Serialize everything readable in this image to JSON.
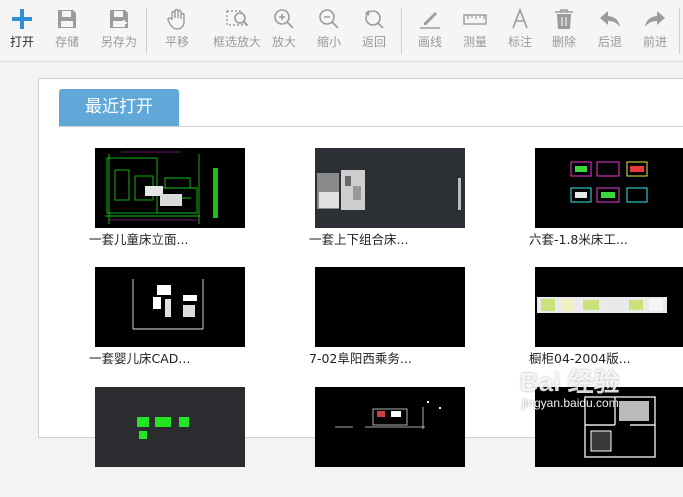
{
  "toolbar": {
    "items": [
      {
        "label": "打开",
        "icon": "plus-icon",
        "state": "active"
      },
      {
        "label": "存储",
        "icon": "save-icon",
        "state": "disabled"
      },
      {
        "label": "另存为",
        "icon": "save-as-icon",
        "state": "disabled"
      },
      {
        "label": "平移",
        "icon": "hand-icon",
        "state": "disabled"
      },
      {
        "label": "框选放大",
        "icon": "zoom-window-icon",
        "state": "disabled"
      },
      {
        "label": "放大",
        "icon": "zoom-in-icon",
        "state": "disabled"
      },
      {
        "label": "缩小",
        "icon": "zoom-out-icon",
        "state": "disabled"
      },
      {
        "label": "返回",
        "icon": "zoom-back-icon",
        "state": "disabled"
      },
      {
        "label": "画线",
        "icon": "pencil-icon",
        "state": "disabled"
      },
      {
        "label": "测量",
        "icon": "ruler-icon",
        "state": "disabled"
      },
      {
        "label": "标注",
        "icon": "text-a-icon",
        "state": "disabled"
      },
      {
        "label": "删除",
        "icon": "trash-icon",
        "state": "disabled"
      },
      {
        "label": "后退",
        "icon": "undo-arrow-icon",
        "state": "disabled"
      },
      {
        "label": "前进",
        "icon": "redo-arrow-icon",
        "state": "disabled"
      }
    ]
  },
  "recent": {
    "tab_label": "最近打开",
    "files": [
      {
        "name": "一套儿童床立面...",
        "thumb": "bed-elevation"
      },
      {
        "name": "一套上下组合床...",
        "thumb": "bunk-bed"
      },
      {
        "name": "六套-1.8米床工...",
        "thumb": "bed-set"
      },
      {
        "name": "一套婴儿床CAD...",
        "thumb": "crib"
      },
      {
        "name": "7-02阜阳西乘务...",
        "thumb": "blank"
      },
      {
        "name": "橱柜04-2004版...",
        "thumb": "cabinet"
      },
      {
        "name": "",
        "thumb": "green-blocks"
      },
      {
        "name": "",
        "thumb": "plan-white"
      },
      {
        "name": "",
        "thumb": "floor-plan"
      }
    ]
  },
  "watermark": {
    "main": "Bai 经验",
    "sub": "jingyan.baidu.com"
  },
  "colors": {
    "tab_bg": "#5fa8d8",
    "toolbar_active_icon": "#2f8ed6",
    "toolbar_disabled_icon": "#9b9b9b",
    "thumb_bg": "#000000"
  }
}
